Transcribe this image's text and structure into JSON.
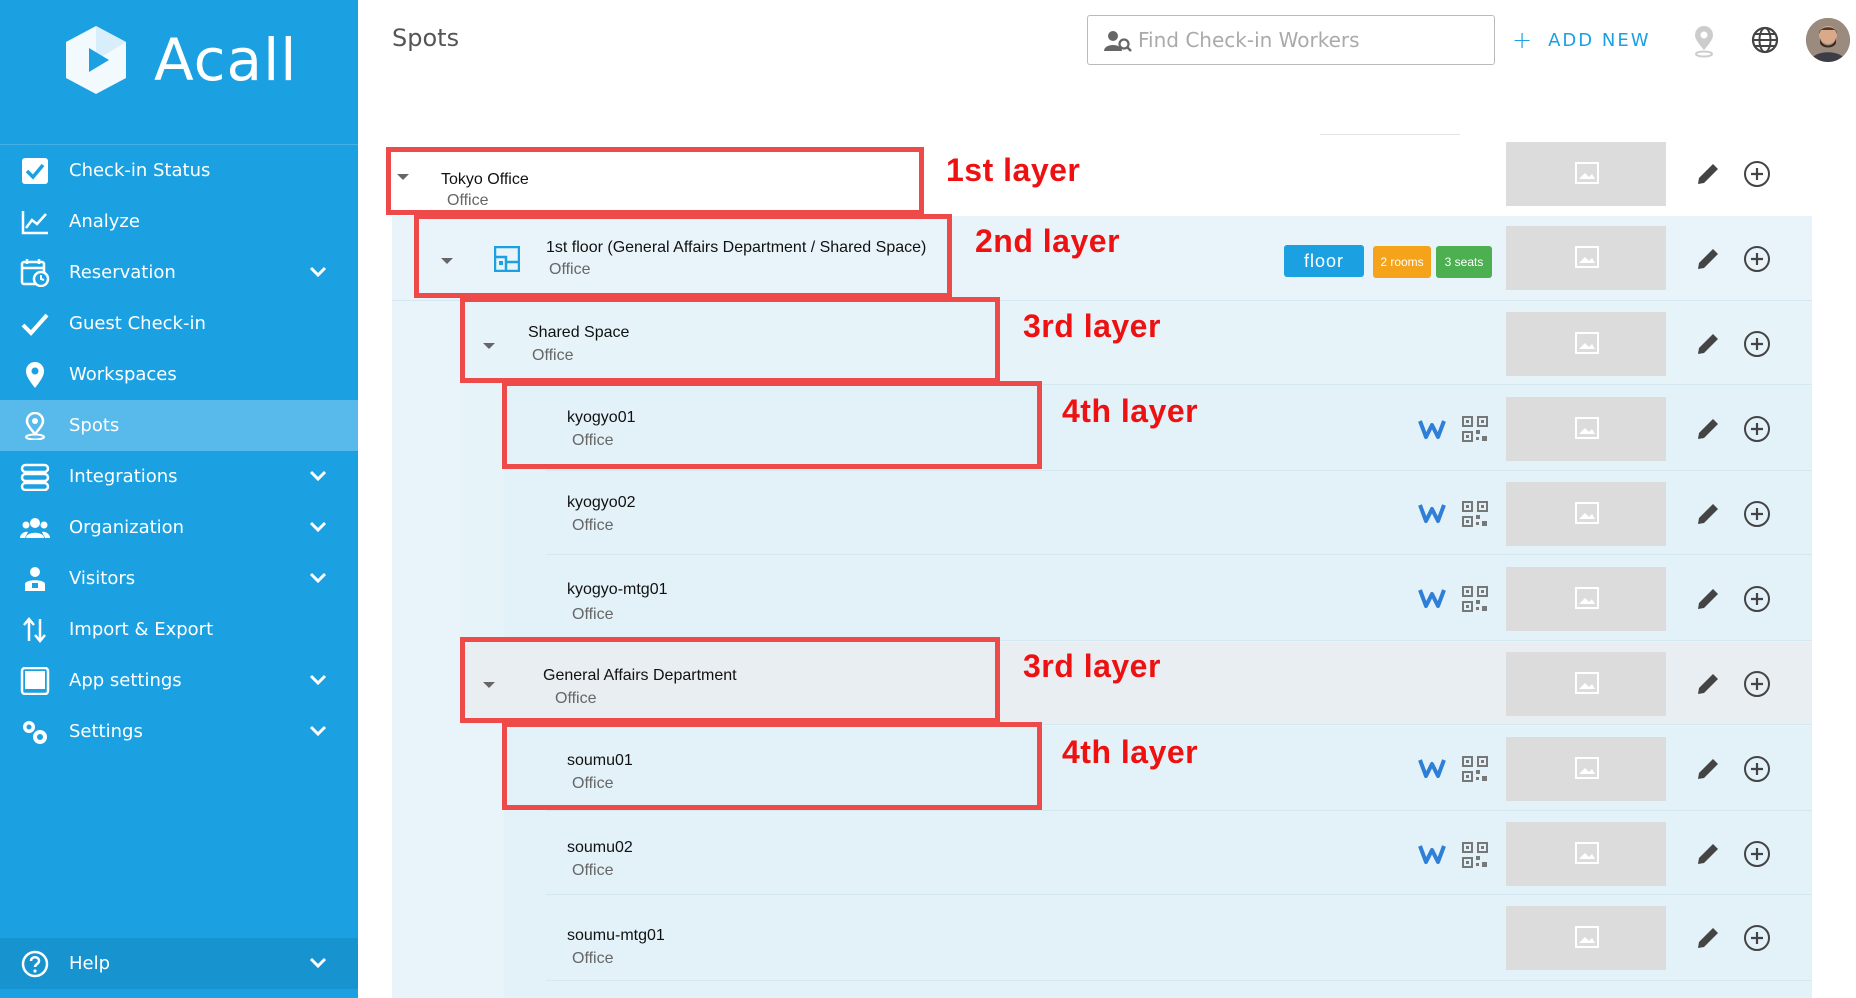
{
  "app": {
    "name": "Acall"
  },
  "sidebar": {
    "items": [
      {
        "label": "Check-in Status",
        "icon": "check-square-icon"
      },
      {
        "label": "Analyze",
        "icon": "line-chart-icon"
      },
      {
        "label": "Reservation",
        "icon": "calendar-clock-icon",
        "expandable": true
      },
      {
        "label": "Guest Check-in",
        "icon": "checkmark-icon"
      },
      {
        "label": "Workspaces",
        "icon": "location-pin-icon"
      },
      {
        "label": "Spots",
        "icon": "person-pin-icon",
        "active": true
      },
      {
        "label": "Integrations",
        "icon": "integrations-icon",
        "expandable": true
      },
      {
        "label": "Organization",
        "icon": "group-icon",
        "expandable": true
      },
      {
        "label": "Visitors",
        "icon": "visitor-icon",
        "expandable": true
      },
      {
        "label": "Import & Export",
        "icon": "import-export-icon"
      },
      {
        "label": "App settings",
        "icon": "tablet-icon",
        "expandable": true
      },
      {
        "label": "Settings",
        "icon": "gears-icon",
        "expandable": true
      }
    ],
    "help": {
      "label": "Help",
      "icon": "help-circle-icon"
    }
  },
  "header": {
    "title": "Spots",
    "search_placeholder": "Find Check-in Workers",
    "add_new_label": "ADD NEW"
  },
  "tree": [
    {
      "name": "Tokyo Office",
      "type": "Office",
      "level": 1,
      "collapsible": true
    },
    {
      "name": "1st floor (General Affairs Department / Shared Space)",
      "type": "Office",
      "level": 2,
      "collapsible": true,
      "badges": [
        "floor",
        "2 rooms",
        "3 seats"
      ]
    },
    {
      "name": "Shared Space",
      "type": "Office",
      "level": 3,
      "collapsible": true
    },
    {
      "name": "kyogyo01",
      "type": "Office",
      "level": 4,
      "integrations": true
    },
    {
      "name": "kyogyo02",
      "type": "Office",
      "level": 4,
      "integrations": true
    },
    {
      "name": "kyogyo-mtg01",
      "type": "Office",
      "level": 4,
      "integrations": true
    },
    {
      "name": "General Affairs Department",
      "type": "Office",
      "level": 3,
      "collapsible": true
    },
    {
      "name": "soumu01",
      "type": "Office",
      "level": 4,
      "integrations": true
    },
    {
      "name": "soumu02",
      "type": "Office",
      "level": 4,
      "integrations": true
    },
    {
      "name": "soumu-mtg01",
      "type": "Office",
      "level": 4
    }
  ],
  "badges": {
    "floor": "floor",
    "rooms": "2 rooms",
    "seats": "3 seats"
  },
  "annotations": [
    "1st layer",
    "2nd layer",
    "3rd layer",
    "4th layer",
    "3rd layer",
    "4th layer"
  ],
  "colors": {
    "sidebar": "#1ba1e2",
    "sidebar_active": "#58b9eb",
    "accent": "#1ba1e2",
    "badge_rooms": "#f5a31a",
    "badge_seats": "#4caf50",
    "annotation": "#ef4a4a",
    "row_tint": "#e8f4fa"
  }
}
